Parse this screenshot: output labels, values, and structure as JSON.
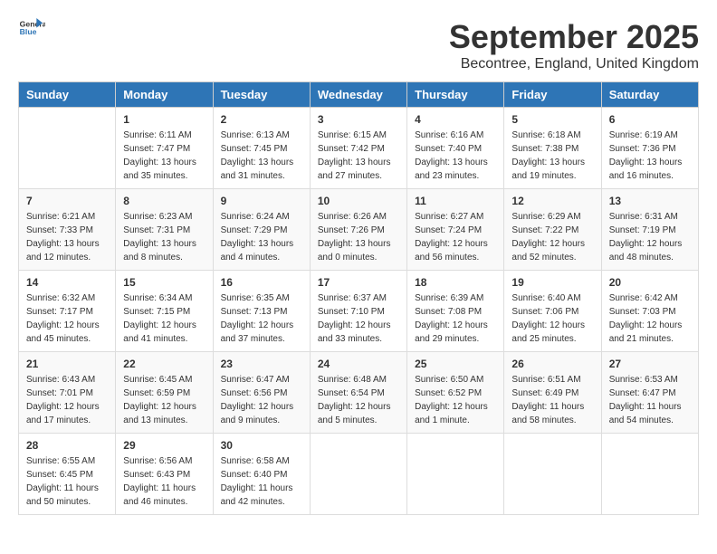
{
  "logo": {
    "general": "General",
    "blue": "Blue"
  },
  "title": "September 2025",
  "location": "Becontree, England, United Kingdom",
  "weekdays": [
    "Sunday",
    "Monday",
    "Tuesday",
    "Wednesday",
    "Thursday",
    "Friday",
    "Saturday"
  ],
  "weeks": [
    [
      {
        "day": "",
        "info": ""
      },
      {
        "day": "1",
        "info": "Sunrise: 6:11 AM\nSunset: 7:47 PM\nDaylight: 13 hours\nand 35 minutes."
      },
      {
        "day": "2",
        "info": "Sunrise: 6:13 AM\nSunset: 7:45 PM\nDaylight: 13 hours\nand 31 minutes."
      },
      {
        "day": "3",
        "info": "Sunrise: 6:15 AM\nSunset: 7:42 PM\nDaylight: 13 hours\nand 27 minutes."
      },
      {
        "day": "4",
        "info": "Sunrise: 6:16 AM\nSunset: 7:40 PM\nDaylight: 13 hours\nand 23 minutes."
      },
      {
        "day": "5",
        "info": "Sunrise: 6:18 AM\nSunset: 7:38 PM\nDaylight: 13 hours\nand 19 minutes."
      },
      {
        "day": "6",
        "info": "Sunrise: 6:19 AM\nSunset: 7:36 PM\nDaylight: 13 hours\nand 16 minutes."
      }
    ],
    [
      {
        "day": "7",
        "info": "Sunrise: 6:21 AM\nSunset: 7:33 PM\nDaylight: 13 hours\nand 12 minutes."
      },
      {
        "day": "8",
        "info": "Sunrise: 6:23 AM\nSunset: 7:31 PM\nDaylight: 13 hours\nand 8 minutes."
      },
      {
        "day": "9",
        "info": "Sunrise: 6:24 AM\nSunset: 7:29 PM\nDaylight: 13 hours\nand 4 minutes."
      },
      {
        "day": "10",
        "info": "Sunrise: 6:26 AM\nSunset: 7:26 PM\nDaylight: 13 hours\nand 0 minutes."
      },
      {
        "day": "11",
        "info": "Sunrise: 6:27 AM\nSunset: 7:24 PM\nDaylight: 12 hours\nand 56 minutes."
      },
      {
        "day": "12",
        "info": "Sunrise: 6:29 AM\nSunset: 7:22 PM\nDaylight: 12 hours\nand 52 minutes."
      },
      {
        "day": "13",
        "info": "Sunrise: 6:31 AM\nSunset: 7:19 PM\nDaylight: 12 hours\nand 48 minutes."
      }
    ],
    [
      {
        "day": "14",
        "info": "Sunrise: 6:32 AM\nSunset: 7:17 PM\nDaylight: 12 hours\nand 45 minutes."
      },
      {
        "day": "15",
        "info": "Sunrise: 6:34 AM\nSunset: 7:15 PM\nDaylight: 12 hours\nand 41 minutes."
      },
      {
        "day": "16",
        "info": "Sunrise: 6:35 AM\nSunset: 7:13 PM\nDaylight: 12 hours\nand 37 minutes."
      },
      {
        "day": "17",
        "info": "Sunrise: 6:37 AM\nSunset: 7:10 PM\nDaylight: 12 hours\nand 33 minutes."
      },
      {
        "day": "18",
        "info": "Sunrise: 6:39 AM\nSunset: 7:08 PM\nDaylight: 12 hours\nand 29 minutes."
      },
      {
        "day": "19",
        "info": "Sunrise: 6:40 AM\nSunset: 7:06 PM\nDaylight: 12 hours\nand 25 minutes."
      },
      {
        "day": "20",
        "info": "Sunrise: 6:42 AM\nSunset: 7:03 PM\nDaylight: 12 hours\nand 21 minutes."
      }
    ],
    [
      {
        "day": "21",
        "info": "Sunrise: 6:43 AM\nSunset: 7:01 PM\nDaylight: 12 hours\nand 17 minutes."
      },
      {
        "day": "22",
        "info": "Sunrise: 6:45 AM\nSunset: 6:59 PM\nDaylight: 12 hours\nand 13 minutes."
      },
      {
        "day": "23",
        "info": "Sunrise: 6:47 AM\nSunset: 6:56 PM\nDaylight: 12 hours\nand 9 minutes."
      },
      {
        "day": "24",
        "info": "Sunrise: 6:48 AM\nSunset: 6:54 PM\nDaylight: 12 hours\nand 5 minutes."
      },
      {
        "day": "25",
        "info": "Sunrise: 6:50 AM\nSunset: 6:52 PM\nDaylight: 12 hours\nand 1 minute."
      },
      {
        "day": "26",
        "info": "Sunrise: 6:51 AM\nSunset: 6:49 PM\nDaylight: 11 hours\nand 58 minutes."
      },
      {
        "day": "27",
        "info": "Sunrise: 6:53 AM\nSunset: 6:47 PM\nDaylight: 11 hours\nand 54 minutes."
      }
    ],
    [
      {
        "day": "28",
        "info": "Sunrise: 6:55 AM\nSunset: 6:45 PM\nDaylight: 11 hours\nand 50 minutes."
      },
      {
        "day": "29",
        "info": "Sunrise: 6:56 AM\nSunset: 6:43 PM\nDaylight: 11 hours\nand 46 minutes."
      },
      {
        "day": "30",
        "info": "Sunrise: 6:58 AM\nSunset: 6:40 PM\nDaylight: 11 hours\nand 42 minutes."
      },
      {
        "day": "",
        "info": ""
      },
      {
        "day": "",
        "info": ""
      },
      {
        "day": "",
        "info": ""
      },
      {
        "day": "",
        "info": ""
      }
    ]
  ]
}
